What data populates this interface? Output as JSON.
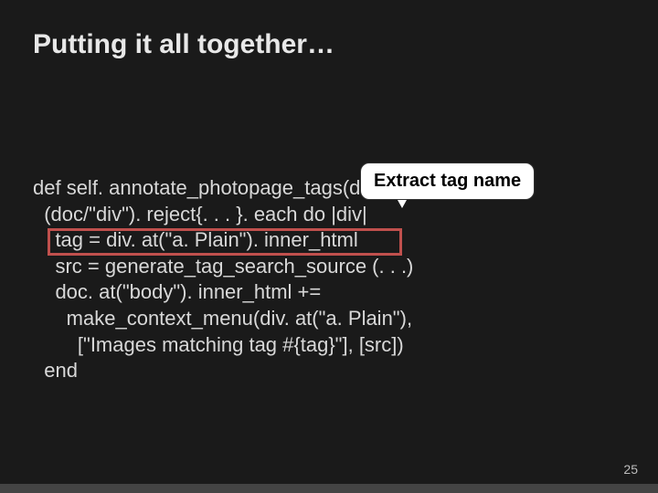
{
  "slide": {
    "title": "Putting it all together…",
    "callout": "Extract tag name",
    "page_number": "25",
    "code": {
      "l1": "def self. annotate_photopage_tags(doc)",
      "l2": "  (doc/\"div\"). reject{. . . }. each do |div|",
      "l3": "    tag = div. at(\"a. Plain\"). inner_html",
      "l4": "    src = generate_tag_search_source (. . .)",
      "l5": "    doc. at(\"body\"). inner_html +=",
      "l6": "      make_context_menu(div. at(\"a. Plain\"),",
      "l7": "        [\"Images matching tag #{tag}\"], [src])",
      "l8": "  end"
    }
  }
}
